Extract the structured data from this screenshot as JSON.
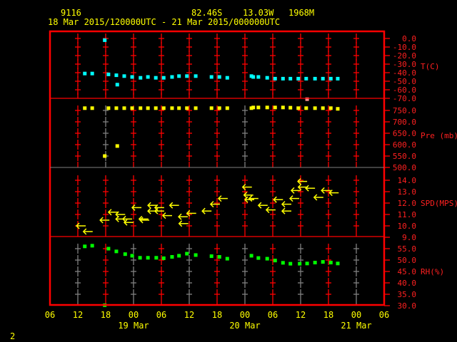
{
  "header": {
    "station": "9116",
    "lat": "82.46S",
    "lon": "13.03W",
    "elev": "1968M",
    "period": "18 Mar 2015/120000UTC - 21 Mar 2015/000000UTC"
  },
  "footer_label": "2",
  "colors": {
    "frame": "#ff0000",
    "grid": "#ff0000",
    "text": "#ffff00",
    "temp": "#00ffff",
    "pres": "#ffff00",
    "wind": "#ffff00",
    "rh": "#00ff00",
    "divider_gray": "#808080"
  },
  "chart_data": {
    "type": "scatter",
    "x_unit": "hours since 18 Mar 2015 00UTC",
    "xlim": [
      6,
      78
    ],
    "x_tick_hours": [
      6,
      12,
      18,
      24,
      30,
      36,
      42,
      48,
      54,
      60,
      66,
      72,
      78
    ],
    "x_tick_labels": [
      "06",
      "12",
      "18",
      "00",
      "06",
      "12",
      "18",
      "00",
      "06",
      "12",
      "18",
      "00",
      "06"
    ],
    "date_labels": [
      {
        "hour": 24,
        "label": "19 Mar"
      },
      {
        "hour": 48,
        "label": "20 Mar"
      },
      {
        "hour": 72,
        "label": "21 Mar"
      }
    ],
    "panels": [
      {
        "name": "temperature",
        "ylabel": "T(C)",
        "ylim": [
          -70,
          0
        ],
        "ticks": [
          0,
          -10,
          -20,
          -30,
          -40,
          -50,
          -60,
          -70
        ],
        "tick_labels": [
          "0.0",
          "-10.0",
          "-20.0",
          "-30.0",
          "-40.0",
          "-50.0",
          "-60.0",
          "-70.0"
        ],
        "points": [
          [
            13.5,
            -41
          ],
          [
            15.1,
            -41
          ],
          [
            17.8,
            -2
          ],
          [
            18.6,
            -42
          ],
          [
            20.3,
            -43
          ],
          [
            20.5,
            -54
          ],
          [
            22,
            -44
          ],
          [
            23.7,
            -45
          ],
          [
            25.5,
            -46
          ],
          [
            27.1,
            -45
          ],
          [
            28.8,
            -46
          ],
          [
            30.5,
            -46
          ],
          [
            32.3,
            -45
          ],
          [
            33.8,
            -44
          ],
          [
            35.5,
            -44
          ],
          [
            37.4,
            -44
          ],
          [
            40.8,
            -45
          ],
          [
            42.5,
            -45
          ],
          [
            44.2,
            -46
          ],
          [
            49.4,
            -44
          ],
          [
            49.8,
            -45
          ],
          [
            50.9,
            -45
          ],
          [
            52.8,
            -46
          ],
          [
            54.5,
            -47
          ],
          [
            56.2,
            -47
          ],
          [
            57.8,
            -47
          ],
          [
            59.5,
            -47
          ],
          [
            61.2,
            -47
          ],
          [
            61.4,
            -71
          ],
          [
            63.1,
            -47
          ],
          [
            64.8,
            -47
          ],
          [
            66.5,
            -47
          ],
          [
            68,
            -47
          ]
        ]
      },
      {
        "name": "pressure",
        "ylabel": "Pre (mb)",
        "ylim": [
          500,
          775
        ],
        "ticks": [
          750,
          700,
          650,
          600,
          550,
          500
        ],
        "tick_labels": [
          "750.0",
          "700.0",
          "650.0",
          "600.0",
          "550.0",
          "500.0"
        ],
        "points": [
          [
            13.5,
            760
          ],
          [
            15.1,
            760
          ],
          [
            17.8,
            550
          ],
          [
            18.6,
            760
          ],
          [
            20.3,
            760
          ],
          [
            20.5,
            594
          ],
          [
            22,
            760
          ],
          [
            23.7,
            760
          ],
          [
            25.5,
            760
          ],
          [
            27.1,
            760
          ],
          [
            28.8,
            760
          ],
          [
            30.5,
            760
          ],
          [
            32.3,
            760
          ],
          [
            33.8,
            760
          ],
          [
            35.5,
            760
          ],
          [
            37.4,
            760
          ],
          [
            40.8,
            760
          ],
          [
            42.5,
            760
          ],
          [
            44.2,
            760
          ],
          [
            49.4,
            760
          ],
          [
            49.8,
            763
          ],
          [
            50.9,
            763
          ],
          [
            52.8,
            763
          ],
          [
            54.5,
            763
          ],
          [
            56.2,
            763
          ],
          [
            57.8,
            762
          ],
          [
            59.5,
            760
          ],
          [
            61.2,
            760
          ],
          [
            63.1,
            760
          ],
          [
            64.8,
            760
          ],
          [
            66.5,
            760
          ],
          [
            68,
            757
          ]
        ]
      },
      {
        "name": "wind_speed",
        "ylabel": "SPD(MPS)",
        "ylim": [
          9,
          14.6
        ],
        "ticks": [
          14,
          13,
          12,
          11,
          10,
          9
        ],
        "tick_labels": [
          "14.0",
          "13.0",
          "12.0",
          "11.0",
          "10.0",
          "9.0"
        ],
        "points": [
          [
            11.7,
            10.0
          ],
          [
            13.2,
            9.5
          ],
          [
            16.8,
            10.5
          ],
          [
            18.6,
            11.2
          ],
          [
            20.2,
            11.0
          ],
          [
            20.2,
            10.6
          ],
          [
            21.7,
            10.6
          ],
          [
            22,
            10.3
          ],
          [
            25.2,
            10.6
          ],
          [
            25.4,
            10.5
          ],
          [
            23.7,
            11.6
          ],
          [
            27.1,
            11.8
          ],
          [
            27.1,
            11.3
          ],
          [
            28.6,
            11.6
          ],
          [
            28.6,
            11.3
          ],
          [
            30.3,
            10.9
          ],
          [
            31.8,
            11.8
          ],
          [
            33.7,
            10.8
          ],
          [
            33.8,
            10.2
          ],
          [
            35.5,
            11.1
          ],
          [
            38.8,
            11.3
          ],
          [
            40.6,
            11.9
          ],
          [
            42.3,
            12.4
          ],
          [
            47.5,
            13.4
          ],
          [
            47.8,
            12.7
          ],
          [
            48,
            12.3
          ],
          [
            48.9,
            12.4
          ],
          [
            50.9,
            11.8
          ],
          [
            52.6,
            11.4
          ],
          [
            54.2,
            12.3
          ],
          [
            56,
            11.9
          ],
          [
            56,
            11.3
          ],
          [
            57.7,
            12.4
          ],
          [
            58,
            13.1
          ],
          [
            59.4,
            13.9
          ],
          [
            59.5,
            13.4
          ],
          [
            61.1,
            13.3
          ],
          [
            62.9,
            12.5
          ],
          [
            64.5,
            13.1
          ],
          [
            66.2,
            12.9
          ]
        ]
      },
      {
        "name": "relative_humidity",
        "ylabel": "RH(%)",
        "ylim": [
          30,
          60
        ],
        "ticks": [
          55,
          50,
          45,
          40,
          35,
          30
        ],
        "tick_labels": [
          "55.0",
          "50.0",
          "45.0",
          "40.0",
          "35.0",
          "30.0"
        ],
        "points": [
          [
            13.5,
            56.0
          ],
          [
            15.1,
            56.3
          ],
          [
            17.8,
            30.2
          ],
          [
            18.6,
            55.0
          ],
          [
            20.3,
            53.8
          ],
          [
            22.2,
            52.6
          ],
          [
            23.7,
            51.9
          ],
          [
            25.4,
            51.0
          ],
          [
            27.1,
            51.0
          ],
          [
            28.9,
            51.0
          ],
          [
            30.5,
            50.8
          ],
          [
            32.3,
            51.4
          ],
          [
            33.8,
            51.9
          ],
          [
            35.5,
            52.8
          ],
          [
            37.4,
            52.2
          ],
          [
            40.8,
            51.7
          ],
          [
            42.5,
            51.4
          ],
          [
            44.2,
            50.6
          ],
          [
            49.4,
            51.9
          ],
          [
            50.9,
            50.9
          ],
          [
            52.8,
            50.6
          ],
          [
            54.5,
            49.8
          ],
          [
            56.2,
            48.8
          ],
          [
            57.8,
            48.4
          ],
          [
            59.8,
            48.4
          ],
          [
            61.4,
            48.5
          ],
          [
            63.1,
            48.9
          ],
          [
            64.8,
            49.2
          ],
          [
            66.5,
            48.9
          ],
          [
            68,
            48.5
          ]
        ]
      }
    ]
  }
}
